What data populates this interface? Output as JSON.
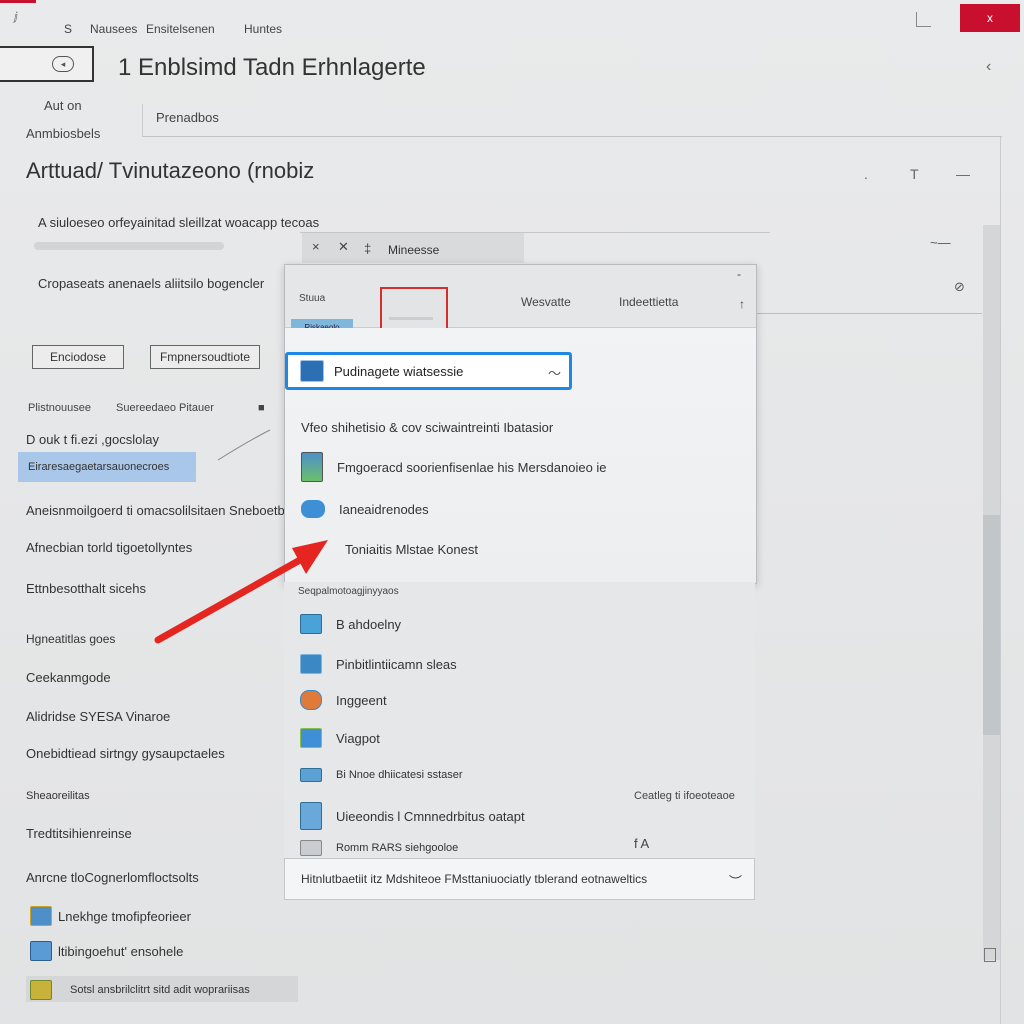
{
  "titlebar": {
    "app_mini": "ⅉ",
    "menu": [
      "S",
      "Nausees",
      "Ensitelsenen",
      "Huntes"
    ],
    "close_label": "x"
  },
  "header": {
    "page_title": "1 Enblsimd Tadn Erhnlagerte"
  },
  "nav": {
    "line1": "Aut on",
    "line2": "Anmbiosbels",
    "tab": "Prenadbos"
  },
  "section": {
    "title": "Arttuad/ Tvinutazeono (rnobiz",
    "tools": [
      ".",
      "T",
      "—"
    ]
  },
  "form": {
    "label1": "A siuloeseo orfeyainitad sleillzat woacapp tecoas",
    "label2": "Cropaseats anenaels aliitsilo bogencler",
    "button1": "Enciodose",
    "button2": "Fmpnersoudtiote"
  },
  "left_list": {
    "small_a": "Plistnouusee",
    "small_b": "Suereedaeo Pitauer",
    "combo": "D ouk t fi.ezi ,gocslolay",
    "selected": "Eiraresaegaetarsauonecroes",
    "items": [
      "Aneisnmoilgoerd ti omacsolilsitaen Sneboetbers",
      "Afnecbian torld tigoetollyntes",
      "Ettnbesotthalt sicehs",
      "Hgneatitlas goes",
      "Ceekanmgode",
      "Alidridse SYESA Vinaroe",
      "Onebidtiead sirtngy gysaupctaeles",
      "Sheaoreilitas",
      "Tredtitsihienreinse",
      "Anrcne tloCognerlomfloctsolts"
    ],
    "icon_items": [
      "Lnekhge tmofipfeorieer",
      "ltibingoehut' ensohele",
      "Sotsl ansbrilclitrt sitd adit woprariisas"
    ]
  },
  "backdrop": {
    "tools": [
      "×",
      "✕",
      "‡"
    ],
    "label": "Mineesse",
    "mark": "~—",
    "corner": "⊘"
  },
  "popup": {
    "head_left": "Stuua",
    "head_right1": "Wesvatte",
    "head_right2": "Indeettietta",
    "close_tick": "-",
    "chip": "Riskaeolo",
    "dropdown_value": "Pudinagete wiatsessie",
    "dropdown_chevron": "〜",
    "row1": "Vfeo shihetisio & cov sciwaintreinti   Ibatasior",
    "row2": "Fmgoeracd soorienfisenlae his Mersdanoieo ie",
    "row3": "Ianeaidrenodes",
    "row4": "Toniaitis Mlstae Konest"
  },
  "list": {
    "header": "Seqpalmotoagjinyyaos",
    "items": [
      "B ahdoelny",
      "Pinbitlintiicamn sleas",
      "Inggeent",
      "Viagpot",
      "Bi Nnoe dhiicatesi sstaser",
      "Uieeondis l Cmnnedrbitus oatapt",
      "Romm RARS siehgooloe"
    ],
    "right_note": "Ceatleg ti ifoeoteaoe",
    "right_mark": "f A",
    "footer": "Hitnlutbaetiit itz Mdshiteoe FMsttaniuociatly tblerand eotnaweltics"
  },
  "colors": {
    "accent": "#1e88e5",
    "close": "#c8102e",
    "selection": "#a9c7e8",
    "arrow": "#e52620"
  }
}
